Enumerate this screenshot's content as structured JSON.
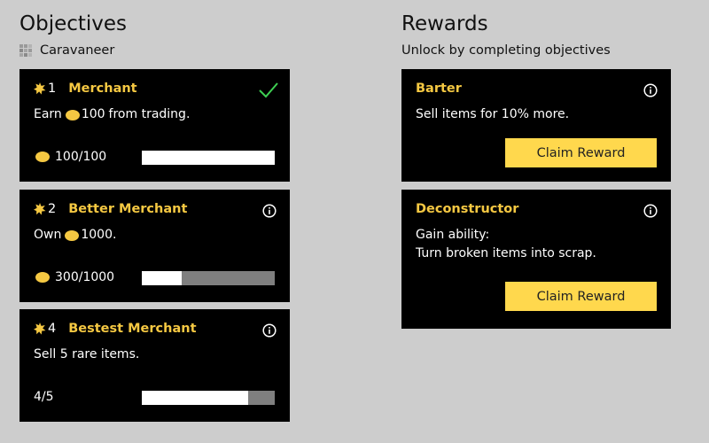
{
  "objectives": {
    "heading": "Objectives",
    "category": "Caravaneer",
    "items": [
      {
        "num": "1",
        "title": "Merchant",
        "desc_pre": "Earn",
        "desc_amount": "100",
        "desc_post": "from trading.",
        "progress": "100/100",
        "fraction": 1.0,
        "completed": true
      },
      {
        "num": "2",
        "title": "Better Merchant",
        "desc_pre": "Own",
        "desc_amount": "1000.",
        "desc_post": "",
        "progress": "300/1000",
        "fraction": 0.3,
        "completed": false
      },
      {
        "num": "4",
        "title": "Bestest Merchant",
        "desc_plain": "Sell 5 rare items.",
        "progress": "4/5",
        "fraction": 0.8,
        "completed": false
      }
    ]
  },
  "rewards": {
    "heading": "Rewards",
    "subtitle": "Unlock by completing objectives",
    "items": [
      {
        "title": "Barter",
        "desc_lines": [
          "Sell items for 10% more."
        ],
        "button": "Claim Reward"
      },
      {
        "title": "Deconstructor",
        "desc_lines": [
          "Gain ability:",
          "Turn broken items into scrap."
        ],
        "button": "Claim Reward"
      }
    ]
  },
  "colors": {
    "accent": "#f5c842",
    "button": "#ffd84d",
    "check": "#3ecf52",
    "card": "#000000",
    "background": "#cdcdcd"
  },
  "icons": {
    "category": "grid-icon",
    "objective": "star-icon",
    "currency": "coin-icon",
    "done": "check-icon",
    "info": "info-icon"
  }
}
